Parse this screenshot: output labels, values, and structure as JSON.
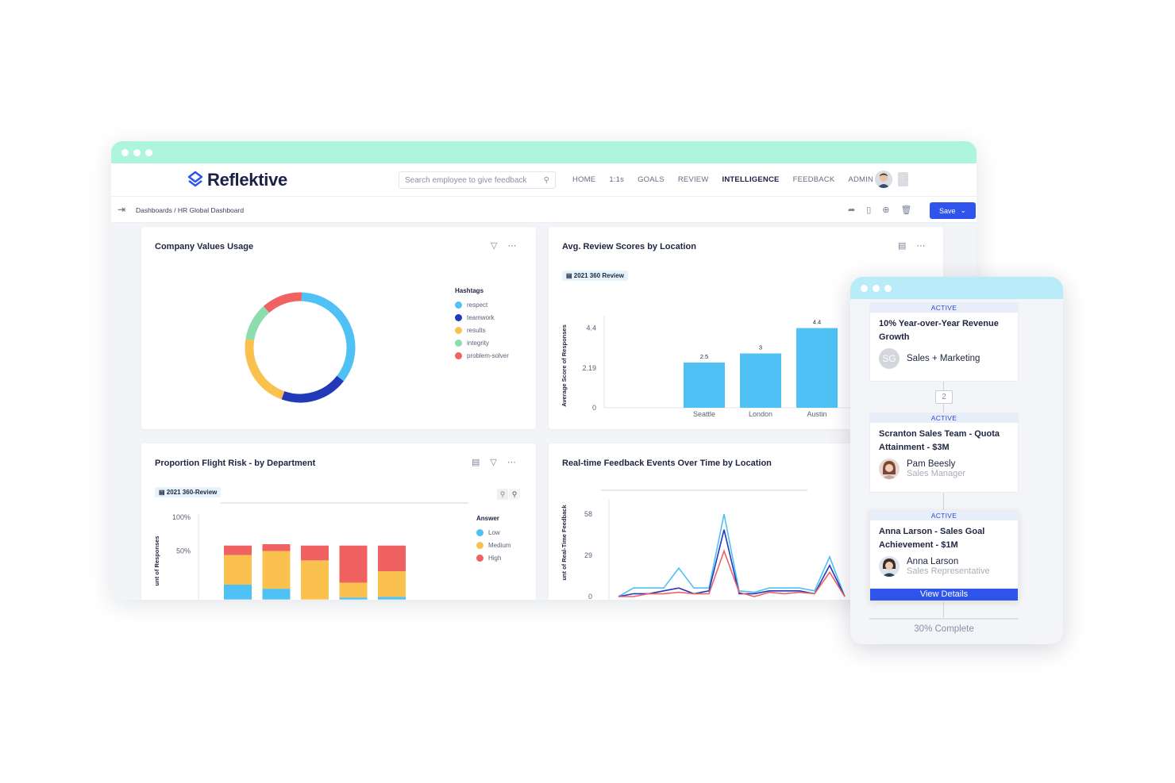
{
  "app": {
    "brand": "Reflektive",
    "search_placeholder": "Search employee to give feedback",
    "menu": [
      "HOME",
      "1:1s",
      "GOALS",
      "REVIEW",
      "INTELLIGENCE",
      "FEEDBACK",
      "ADMIN"
    ],
    "active_menu": "INTELLIGENCE",
    "breadcrumb": "Dashboards  /  HR Global Dashboard",
    "save_label": "Save",
    "accent_color": "#2f54eb",
    "titlebar_color": "#aef5de"
  },
  "cards": {
    "values_usage": {
      "title": "Company Values Usage",
      "legend_title": "Hashtags",
      "legend": [
        "respect",
        "teamwork",
        "results",
        "integrity",
        "problem-solver"
      ]
    },
    "review_scores": {
      "title": "Avg. Review Scores by Location",
      "tag": "2021 360 Review",
      "ylabel": "Average Score of Responses"
    },
    "flight_risk": {
      "title": "Proportion Flight Risk - by Department",
      "tag": "2021 360-Review",
      "ylabel": "unt of Responses",
      "legend_title": "Answer",
      "legend": [
        "Low",
        "Medium",
        "High"
      ]
    },
    "feedback_events": {
      "title": "Real-time Feedback Events Over Time by Location",
      "ylabel": "unt of Real-Time Feedback"
    }
  },
  "chart_data": [
    {
      "type": "pie",
      "title": "Company Values Usage",
      "categories": [
        "respect",
        "teamwork",
        "results",
        "integrity",
        "problem-solver"
      ],
      "values": [
        35,
        20,
        22,
        11,
        12
      ],
      "colors": [
        "#4fc1f5",
        "#2239b8",
        "#fbc14e",
        "#8ddcaf",
        "#f06262"
      ]
    },
    {
      "type": "bar",
      "title": "Avg. Review Scores by Location",
      "categories": [
        "Seattle",
        "London",
        "Austin"
      ],
      "values": [
        2.5,
        3,
        4.4
      ],
      "data_labels": [
        "2.5",
        "3",
        "4.4"
      ],
      "yticks": [
        "0",
        "2.19",
        "4.4"
      ],
      "ylim": [
        0,
        4.4
      ],
      "ylabel": "Average Score of Responses",
      "color": "#4fc1f5"
    },
    {
      "type": "bar",
      "title": "Proportion Flight Risk - by Department",
      "yticks": [
        "50%",
        "100%"
      ],
      "series": [
        {
          "name": "Low",
          "values": [
            22,
            16,
            0,
            3,
            4
          ],
          "color": "#4fc1f5"
        },
        {
          "name": "Medium",
          "values": [
            44,
            56,
            58,
            22,
            38
          ],
          "color": "#fbc14e"
        },
        {
          "name": "High",
          "values": [
            14,
            10,
            22,
            55,
            38
          ],
          "color": "#f06262"
        }
      ]
    },
    {
      "type": "line",
      "title": "Real-time Feedback Events Over Time by Location",
      "yticks": [
        "0",
        "29",
        "58"
      ],
      "series": [
        {
          "values": [
            0,
            6,
            6,
            6,
            20,
            6,
            6,
            58,
            4,
            3,
            6,
            6,
            6,
            4,
            28,
            0
          ],
          "color": "#4fc1f5"
        },
        {
          "values": [
            0,
            2,
            2,
            4,
            6,
            2,
            4,
            47,
            2,
            2,
            4,
            4,
            4,
            2,
            22,
            0
          ],
          "color": "#2239b8"
        },
        {
          "values": [
            0,
            0,
            2,
            2,
            3,
            2,
            2,
            32,
            3,
            0,
            3,
            2,
            3,
            2,
            17,
            0
          ],
          "color": "#f06262"
        }
      ]
    }
  ],
  "phone": {
    "goals": [
      {
        "badge": "ACTIVE",
        "title": "10% Year-over-Year Revenue Growth",
        "owner_initials": "SG",
        "owner": "Sales + Marketing",
        "role": ""
      },
      {
        "badge": "ACTIVE",
        "title": "Scranton Sales Team - Quota Attainment - $3M",
        "owner": "Pam Beesly",
        "role": "Sales Manager"
      },
      {
        "badge": "ACTIVE",
        "title": "Anna Larson - Sales Goal Achievement - $1M",
        "owner": "Anna Larson",
        "role": "Sales Representative"
      }
    ],
    "step": "2",
    "view_details": "View Details",
    "progress": 0.3,
    "progress_label": "30% Complete"
  }
}
